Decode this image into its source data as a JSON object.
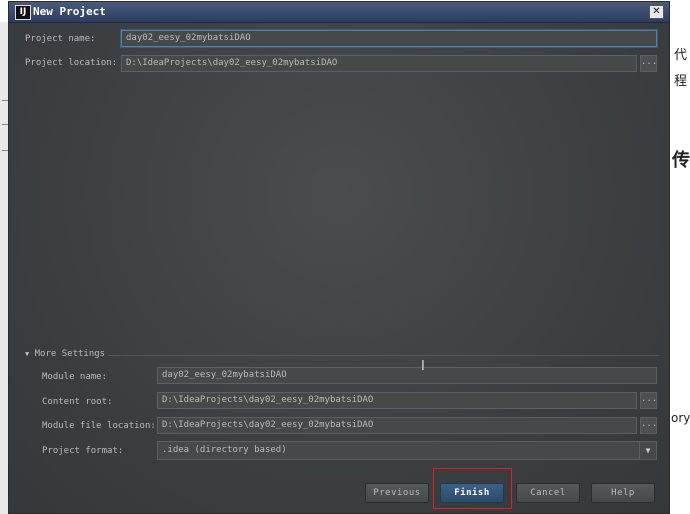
{
  "window": {
    "title": "New Project",
    "icon_label": "IJ",
    "close_label": "✕"
  },
  "project": {
    "name_label": "Project name:",
    "name_value": "day02_eesy_02mybatsiDAO",
    "location_label": "Project location:",
    "location_value": "D:\\IdeaProjects\\day02_eesy_02mybatsiDAO",
    "browse_label": "..."
  },
  "more_settings": {
    "title": "More Settings",
    "toggle_icon": "▼",
    "module_name_label": "Module name:",
    "module_name_value": "day02_eesy_02mybatsiDAO",
    "content_root_label": "Content root:",
    "content_root_value": "D:\\IdeaProjects\\day02_eesy_02mybatsiDAO",
    "module_file_label": "Module file location:",
    "module_file_value": "D:\\IdeaProjects\\day02_eesy_02mybatsiDAO",
    "format_label": "Project format:",
    "format_value": ".idea (directory based)",
    "browse_label": "..."
  },
  "buttons": {
    "previous": "Previous",
    "finish": "Finish",
    "cancel": "Cancel",
    "help": "Help"
  },
  "background": {
    "glyph_1": "代",
    "glyph_2": "程",
    "glyph_3": "传",
    "word_1": "ory"
  },
  "colors": {
    "highlight": "#e02020",
    "focus": "#4f7eaf"
  }
}
